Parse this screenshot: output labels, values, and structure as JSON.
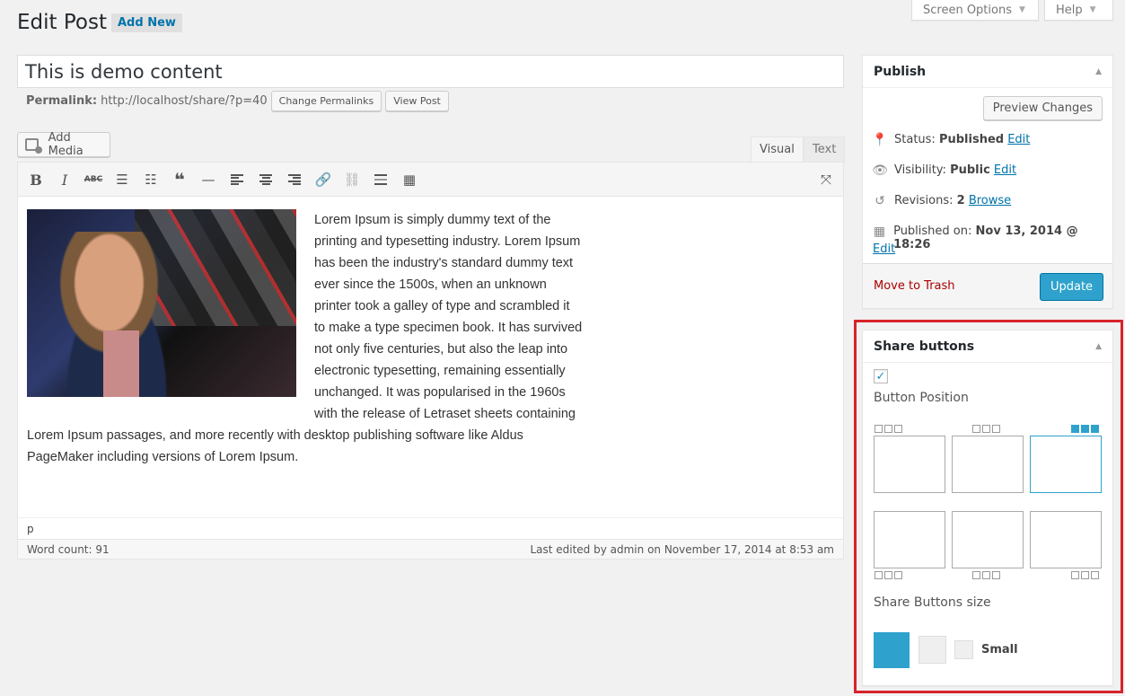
{
  "header": {
    "title": "Edit Post",
    "add_new": "Add New",
    "screen_options": "Screen Options",
    "help": "Help"
  },
  "post": {
    "title": "This is demo content",
    "permalink_label": "Permalink:",
    "permalink_url": "http://localhost/share/?p=40",
    "change_permalinks": "Change Permalinks",
    "view_post": "View Post"
  },
  "editor": {
    "add_media": "Add Media",
    "tab_visual": "Visual",
    "tab_text": "Text",
    "body": "Lorem Ipsum is simply dummy text of the printing and typesetting industry. Lorem Ipsum has been the industry's standard dummy text ever since the 1500s, when an unknown printer took a galley of type and scrambled it to make a type specimen book. It has survived not only five centuries, but also the leap into electronic typesetting, remaining essentially unchanged. It was popularised in the 1960s with the release of Letraset sheets containing Lorem Ipsum passages, and more recently with desktop publishing software like Aldus PageMaker including versions of Lorem Ipsum.",
    "path": "p",
    "word_count": "Word count: 91",
    "last_edited": "Last edited by admin on November 17, 2014 at 8:53 am"
  },
  "publish": {
    "title": "Publish",
    "preview": "Preview Changes",
    "status_label": "Status:",
    "status_value": "Published",
    "visibility_label": "Visibility:",
    "visibility_value": "Public",
    "revisions_label": "Revisions:",
    "revisions_value": "2",
    "browse": "Browse",
    "published_label": "Published on:",
    "published_value": "Nov 13, 2014 @ 18:26",
    "edit": "Edit",
    "trash": "Move to Trash",
    "update": "Update"
  },
  "share": {
    "title": "Share buttons",
    "enabled": true,
    "check_mark": "✓",
    "position_label": "Button Position",
    "size_label": "Share Buttons size",
    "small_label": "Small"
  },
  "colors": {
    "accent": "#2ea2cc",
    "highlight": "#d8232a",
    "link": "#0073aa",
    "trash": "#a00"
  }
}
